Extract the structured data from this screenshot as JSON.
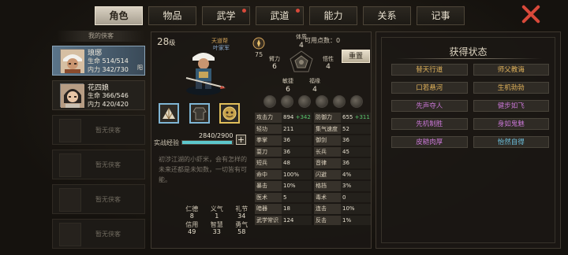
{
  "tabs": [
    {
      "label": "角色",
      "active": true,
      "dot": false
    },
    {
      "label": "物品",
      "active": false,
      "dot": false
    },
    {
      "label": "武学",
      "active": false,
      "dot": true
    },
    {
      "label": "武道",
      "active": false,
      "dot": true
    },
    {
      "label": "能力",
      "active": false,
      "dot": false
    },
    {
      "label": "关系",
      "active": false,
      "dot": false
    },
    {
      "label": "记事",
      "active": false,
      "dot": false
    }
  ],
  "roster": {
    "title": "我的侠客",
    "heroes": [
      {
        "name": "琅琊",
        "hp_label": "生命",
        "hp": "514/514",
        "mp_label": "内力",
        "mp": "342/730",
        "flag": "阳"
      },
      {
        "name": "花四娘",
        "hp_label": "生命",
        "hp": "366/546",
        "mp_label": "内力",
        "mp": "420/420",
        "flag": ""
      }
    ],
    "empty_label": "暂无侠客"
  },
  "character": {
    "level": "28",
    "level_unit": "级",
    "title_top": "天道帮",
    "title_bottom": "叶家军",
    "badge_value": "75",
    "free_points_label": "可用点数：",
    "free_points": "0",
    "reset_label": "重置",
    "attrs": [
      {
        "label": "体质",
        "value": "4"
      },
      {
        "label": "臂力",
        "value": "6"
      },
      {
        "label": "悟性",
        "value": "4"
      },
      {
        "label": "敏捷",
        "value": "6"
      },
      {
        "label": "福缘",
        "value": "4"
      }
    ],
    "exp_label": "实战经验",
    "exp_text": "2840/2900",
    "exp_fraction": 0.979,
    "exp_plus": "+",
    "description": "初涉江湖的小虾米，会有怎样的未来还都是未知数，一切皆有可能。",
    "virtues": [
      {
        "label": "仁德",
        "value": "8"
      },
      {
        "label": "义气",
        "value": "1"
      },
      {
        "label": "礼节",
        "value": "34"
      },
      {
        "label": "信用",
        "value": "49"
      },
      {
        "label": "智慧",
        "value": "33"
      },
      {
        "label": "勇气",
        "value": "58"
      }
    ]
  },
  "stats": [
    {
      "label": "攻击力",
      "value": "894",
      "bonus": "+342"
    },
    {
      "label": "防御力",
      "value": "655",
      "bonus": "+311"
    },
    {
      "label": "轻功",
      "value": "211",
      "bonus": ""
    },
    {
      "label": "集气速度",
      "value": "52",
      "bonus": ""
    },
    {
      "label": "拳掌",
      "value": "36",
      "bonus": ""
    },
    {
      "label": "御剑",
      "value": "36",
      "bonus": ""
    },
    {
      "label": "耍刀",
      "value": "36",
      "bonus": ""
    },
    {
      "label": "长兵",
      "value": "45",
      "bonus": ""
    },
    {
      "label": "短兵",
      "value": "48",
      "bonus": ""
    },
    {
      "label": "音律",
      "value": "36",
      "bonus": ""
    },
    {
      "label": "命中",
      "value": "100%",
      "bonus": ""
    },
    {
      "label": "闪避",
      "value": "4%",
      "bonus": ""
    },
    {
      "label": "暴击",
      "value": "10%",
      "bonus": ""
    },
    {
      "label": "格挡",
      "value": "3%",
      "bonus": ""
    },
    {
      "label": "医术",
      "value": "5",
      "bonus": ""
    },
    {
      "label": "毒术",
      "value": "0",
      "bonus": ""
    },
    {
      "label": "暗器",
      "value": "18",
      "bonus": ""
    },
    {
      "label": "连击",
      "value": "10%",
      "bonus": ""
    },
    {
      "label": "武学常识",
      "value": "124",
      "bonus": ""
    },
    {
      "label": "反击",
      "value": "1%",
      "bonus": ""
    }
  ],
  "status": {
    "title": "获得状态",
    "buffs": [
      {
        "label": "替天行道",
        "color": "#e0b25a"
      },
      {
        "label": "师父教诲",
        "color": "#e0b25a"
      },
      {
        "label": "口若悬河",
        "color": "#e0b25a"
      },
      {
        "label": "生机勃勃",
        "color": "#e0b25a"
      },
      {
        "label": "先声夺人",
        "color": "#c776d4"
      },
      {
        "label": "健步如飞",
        "color": "#c776d4"
      },
      {
        "label": "先机制胜",
        "color": "#c776d4"
      },
      {
        "label": "身如鬼魅",
        "color": "#c776d4"
      },
      {
        "label": "皮糙肉厚",
        "color": "#c776d4"
      },
      {
        "label": "怡然自得",
        "color": "#6cc2e0"
      }
    ]
  },
  "colors": {
    "accent_red": "#d8493a",
    "exp": "#5dc7cc",
    "bonus": "#58c46c"
  }
}
